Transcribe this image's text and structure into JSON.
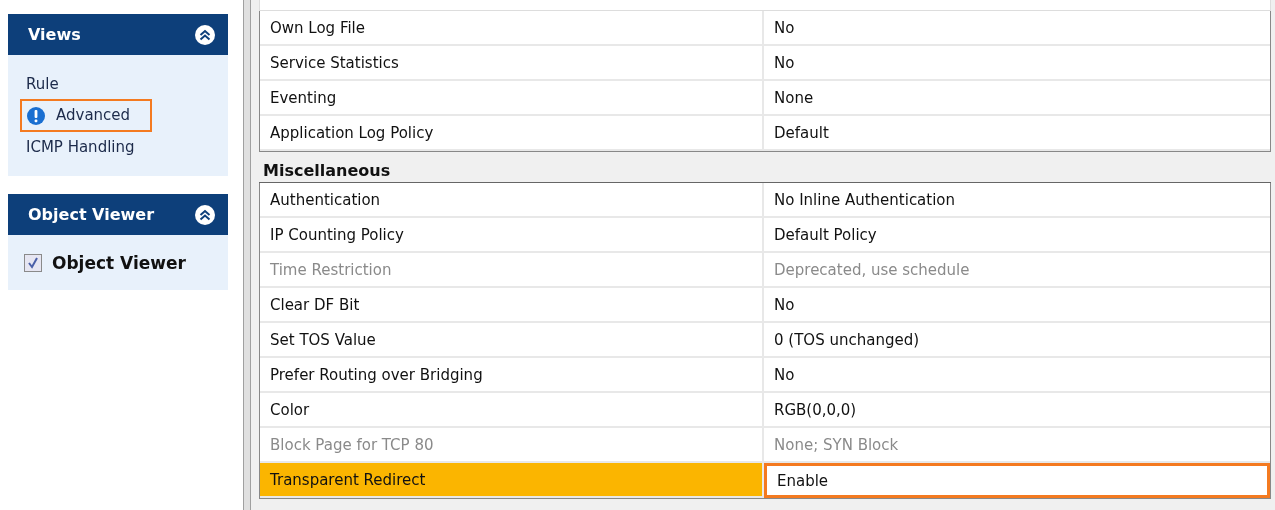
{
  "sidebar": {
    "panels": [
      {
        "title": "Views",
        "kind": "links",
        "items": [
          {
            "label": "Rule",
            "selected": false
          },
          {
            "label": "Advanced",
            "selected": true
          },
          {
            "label": "ICMP Handling",
            "selected": false
          }
        ]
      },
      {
        "title": "Object Viewer",
        "kind": "checks",
        "items": [
          {
            "label": "Object Viewer",
            "checked": true
          }
        ]
      }
    ]
  },
  "sections": [
    {
      "rows": [
        {
          "name": "Own Log File",
          "value": "No",
          "disabled": false,
          "selected": false
        },
        {
          "name": "Service Statistics",
          "value": "No",
          "disabled": false,
          "selected": false
        },
        {
          "name": "Eventing",
          "value": "None",
          "disabled": false,
          "selected": false
        },
        {
          "name": "Application Log Policy",
          "value": "Default",
          "disabled": false,
          "selected": false
        }
      ]
    },
    {
      "title": "Miscellaneous",
      "rows": [
        {
          "name": "Authentication",
          "value": "No Inline Authentication",
          "disabled": false,
          "selected": false
        },
        {
          "name": "IP Counting Policy",
          "value": "Default Policy",
          "disabled": false,
          "selected": false
        },
        {
          "name": "Time Restriction",
          "value": "Deprecated, use schedule",
          "disabled": true,
          "selected": false
        },
        {
          "name": "Clear DF Bit",
          "value": "No",
          "disabled": false,
          "selected": false
        },
        {
          "name": "Set TOS Value",
          "value": "0 (TOS unchanged)",
          "disabled": false,
          "selected": false
        },
        {
          "name": "Prefer Routing over Bridging",
          "value": "No",
          "disabled": false,
          "selected": false
        },
        {
          "name": "Color",
          "value": "RGB(0,0,0)",
          "disabled": false,
          "selected": false
        },
        {
          "name": "Block Page for TCP 80",
          "value": "None; SYN Block",
          "disabled": true,
          "selected": false
        },
        {
          "name": "Transparent Redirect",
          "value": "Enable",
          "disabled": false,
          "selected": true
        }
      ]
    }
  ]
}
